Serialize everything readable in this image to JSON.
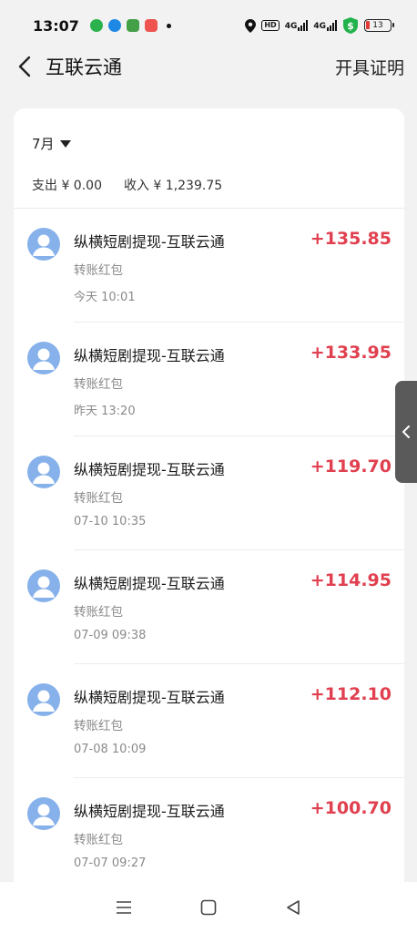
{
  "status": {
    "time": "13:07",
    "hd_label": "HD",
    "network_1": "4G",
    "network_2": "4G",
    "battery": "13"
  },
  "header": {
    "title": "互联云通",
    "action_label": "开具证明"
  },
  "filter": {
    "month": "7月"
  },
  "summary": {
    "expense": "支出 ¥ 0.00",
    "income": "收入 ¥ 1,239.75"
  },
  "transactions": [
    {
      "title": "纵横短剧提现-互联云通",
      "type": "转账红包",
      "time": "今天 10:01",
      "amount": "+135.85"
    },
    {
      "title": "纵横短剧提现-互联云通",
      "type": "转账红包",
      "time": "昨天 13:20",
      "amount": "+133.95"
    },
    {
      "title": "纵横短剧提现-互联云通",
      "type": "转账红包",
      "time": "07-10 10:35",
      "amount": "+119.70"
    },
    {
      "title": "纵横短剧提现-互联云通",
      "type": "转账红包",
      "time": "07-09 09:38",
      "amount": "+114.95"
    },
    {
      "title": "纵横短剧提现-互联云通",
      "type": "转账红包",
      "time": "07-08 10:09",
      "amount": "+112.10"
    },
    {
      "title": "纵横短剧提现-互联云通",
      "type": "转账红包",
      "time": "07-07 09:27",
      "amount": "+100.70"
    }
  ],
  "colors": {
    "amount_positive": "#e0404f",
    "avatar_bg": "#86b1ea",
    "page_bg": "#f2f2f2"
  }
}
